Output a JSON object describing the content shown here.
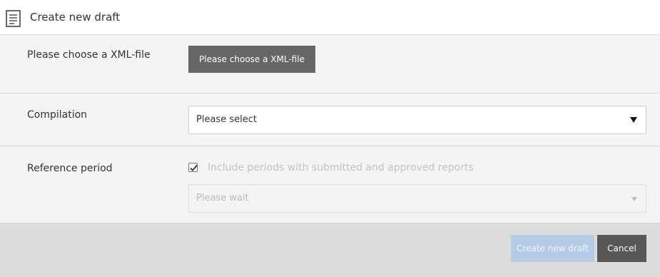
{
  "header": {
    "title": "Create new draft",
    "icon": "document-icon"
  },
  "file_section": {
    "label": "Please choose a XML-file",
    "button_label": "Please choose a XML-file"
  },
  "compilation": {
    "label": "Compilation",
    "selected": "Please select"
  },
  "reference_period": {
    "label": "Reference period",
    "checkbox_label": "Include periods with submitted and approved reports",
    "checkbox_checked": true,
    "select_value": "Please wait",
    "disabled": true
  },
  "footer": {
    "create_label": "Create new draft",
    "create_disabled": true,
    "cancel_label": "Cancel"
  },
  "colors": {
    "section_bg": "#f4f4f4",
    "footer_bg": "#dcdcdc",
    "primary_disabled": "#b5cbe6",
    "dark_button": "#575757"
  }
}
